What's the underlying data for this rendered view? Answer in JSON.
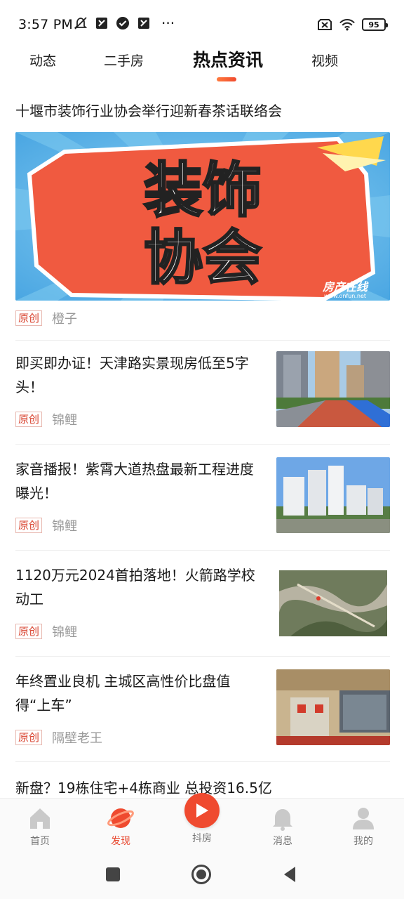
{
  "status_bar": {
    "time": "3:57 PM",
    "left_icons": [
      "mute-icon",
      "app-icon",
      "check-badge-icon",
      "app-icon"
    ],
    "more": "···",
    "battery": "95",
    "right_icons": [
      "sim-off-icon",
      "wifi-icon",
      "battery-icon"
    ]
  },
  "tabs": [
    {
      "label": "动态",
      "active": false
    },
    {
      "label": "二手房",
      "active": false
    },
    {
      "label": "热点资讯",
      "active": true
    },
    {
      "label": "视频",
      "active": false
    }
  ],
  "featured": {
    "title": "十堰市装饰行业协会举行迎新春茶话联络会",
    "image_text_line1": "装饰",
    "image_text_line2": "协会",
    "image_watermark": "房产在线",
    "image_watermark_url": "www.onfun.net",
    "tag": "原创",
    "author": "橙子"
  },
  "articles": [
    {
      "title": "即买即办证！天津路实景现房低至5字头！",
      "tag": "原创",
      "author": "锦鲤"
    },
    {
      "title": "家音播报！紫霄大道热盘最新工程进度曝光！",
      "tag": "原创",
      "author": "锦鲤"
    },
    {
      "title": "1120万元2024首拍落地！火箭路学校动工",
      "tag": "原创",
      "author": "锦鲤"
    },
    {
      "title": "年终置业良机 主城区高性价比盘值得“上车”",
      "tag": "原创",
      "author": "隔壁老王"
    }
  ],
  "last_article": {
    "title": "新盘？19栋住宅+4栋商业 总投资16.5亿"
  },
  "bottom_nav": [
    {
      "label": "首页",
      "icon": "home-icon",
      "active": false
    },
    {
      "label": "发现",
      "icon": "planet-icon",
      "active": true
    },
    {
      "label": "抖房",
      "icon": "play-icon",
      "active": false
    },
    {
      "label": "消息",
      "icon": "bell-icon",
      "active": false
    },
    {
      "label": "我的",
      "icon": "user-icon",
      "active": false
    }
  ],
  "colors": {
    "accent": "#ef4a2f",
    "tag_text": "#d9432f",
    "muted": "#999999"
  }
}
